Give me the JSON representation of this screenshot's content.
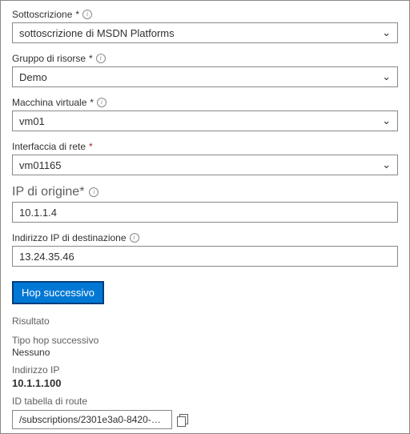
{
  "fields": {
    "subscription": {
      "label": "Sottoscrizione",
      "value": "sottoscrizione di MSDN Platforms"
    },
    "resourceGroup": {
      "label": "Gruppo di risorse",
      "value": "Demo"
    },
    "vm": {
      "label": "Macchina virtuale",
      "value": "vm01"
    },
    "nic": {
      "label": "Interfaccia di rete",
      "value": "vm01165"
    },
    "sourceIp": {
      "label": "IP di origine",
      "value": "10.1.1.4"
    },
    "destIp": {
      "label": "Indirizzo IP di destinazione",
      "value": "13.24.35.46"
    }
  },
  "button": {
    "nextHop": "Hop successivo"
  },
  "result": {
    "heading": "Risultato",
    "nextHopTypeLabel": "Tipo hop successivo",
    "nextHopTypeValue": "Nessuno",
    "ipLabel": "Indirizzo IP",
    "ipValue": "10.1.1.100",
    "routeTableLabel": "ID tabella di route",
    "routeTableValue": "/subscriptions/2301e3a0-8420-…"
  },
  "glyphs": {
    "asterisk": "*",
    "info": "i",
    "chevron": "⌄"
  }
}
